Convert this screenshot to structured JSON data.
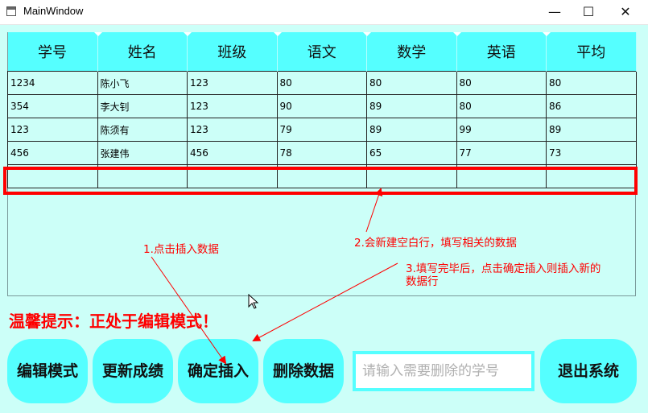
{
  "window": {
    "title": "MainWindow",
    "minimize": "—",
    "maximize": "☐",
    "close": "✕"
  },
  "table": {
    "headers": [
      "学号",
      "姓名",
      "班级",
      "语文",
      "数学",
      "英语",
      "平均"
    ],
    "rows": [
      [
        "1234",
        "陈小飞",
        "123",
        "80",
        "80",
        "80",
        "80"
      ],
      [
        "354",
        "李大钊",
        "123",
        "90",
        "89",
        "80",
        "86"
      ],
      [
        "123",
        "陈须有",
        "123",
        "79",
        "89",
        "99",
        "89"
      ],
      [
        "456",
        "张建伟",
        "456",
        "78",
        "65",
        "77",
        "73"
      ],
      [
        "",
        "",
        "",
        "",
        "",
        "",
        ""
      ]
    ]
  },
  "annotations": {
    "step1": "1.点击插入数据",
    "step2": "2.会新建空白行，填写相关的数据",
    "step3_line1": "3.填写完毕后，点击确定插入则插入新的",
    "step3_line2": "数据行"
  },
  "hint": "温馨提示：正处于编辑模式！",
  "buttons": {
    "edit_mode": "编辑模式",
    "update_scores": "更新成绩",
    "confirm_insert": "确定插入",
    "delete_data": "删除数据",
    "exit_system": "退出系统"
  },
  "delete_input": {
    "placeholder": "请输入需要删除的学号",
    "value": ""
  },
  "colors": {
    "accent": "#55ffff",
    "background": "#ccfff8",
    "annotation": "#ff0000"
  },
  "icons": [
    "app-window-icon",
    "minimize-icon",
    "maximize-icon",
    "close-icon",
    "mouse-cursor-icon"
  ]
}
